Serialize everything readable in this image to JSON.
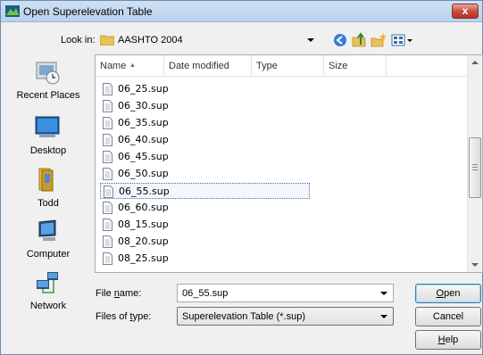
{
  "window": {
    "title": "Open Superelevation Table",
    "close_label": "x"
  },
  "lookin": {
    "label": "Look in:",
    "value": "AASHTO 2004"
  },
  "toolbar": {
    "icons": [
      "back-icon",
      "up-folder-icon",
      "new-folder-icon",
      "views-menu-icon"
    ]
  },
  "places": [
    {
      "label": "Recent Places",
      "icon": "recent-places-icon"
    },
    {
      "label": "Desktop",
      "icon": "desktop-icon"
    },
    {
      "label": "Todd",
      "icon": "user-folder-icon"
    },
    {
      "label": "Computer",
      "icon": "computer-icon"
    },
    {
      "label": "Network",
      "icon": "network-icon"
    }
  ],
  "columns": [
    "Name",
    "Date modified",
    "Type",
    "Size"
  ],
  "files": [
    "06_25.sup",
    "06_30.sup",
    "06_35.sup",
    "06_40.sup",
    "06_45.sup",
    "06_50.sup",
    "06_55.sup",
    "06_60.sup",
    "08_15.sup",
    "08_20.sup",
    "08_25.sup"
  ],
  "selected_file": "06_55.sup",
  "filename": {
    "label_pre": "File ",
    "label_key": "n",
    "label_post": "ame:",
    "value": "06_55.sup"
  },
  "filetype": {
    "label_pre": "Files of ",
    "label_key": "t",
    "label_post": "ype:",
    "value": "Superelevation Table (*.sup)"
  },
  "buttons": {
    "open": {
      "key": "O",
      "rest": "pen"
    },
    "cancel": {
      "label": "Cancel"
    },
    "help": {
      "key": "H",
      "rest": "elp"
    }
  }
}
